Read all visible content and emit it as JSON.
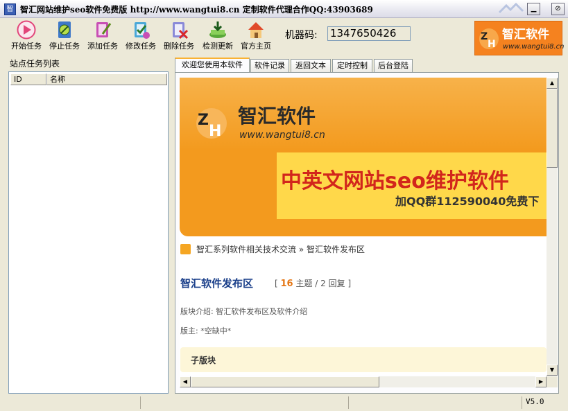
{
  "window": {
    "title": "智汇网站维护seo软件免费版  http://www.wangtui8.cn  定制软件代理合作QQ:43903689",
    "app_icon": "app-icon",
    "minimize_symbol": "▁",
    "close_symbol": "⊘"
  },
  "toolbar": {
    "items": [
      {
        "label": "开始任务",
        "icon": "play-icon"
      },
      {
        "label": "停止任务",
        "icon": "stop-icon"
      },
      {
        "label": "添加任务",
        "icon": "add-task-icon"
      },
      {
        "label": "修改任务",
        "icon": "edit-task-icon"
      },
      {
        "label": "删除任务",
        "icon": "delete-task-icon"
      },
      {
        "label": "检测更新",
        "icon": "update-icon"
      },
      {
        "label": "官方主页",
        "icon": "home-page-icon"
      }
    ],
    "machine_code_label": "机器码:",
    "machine_code_value": "1347650426"
  },
  "logo": {
    "text": "智汇软件",
    "url": "www.wangtui8.cn",
    "mark": "ZH"
  },
  "left_panel": {
    "title": "站点任务列表",
    "columns": [
      "ID",
      "名称"
    ]
  },
  "tabs": [
    {
      "label": "欢迎您使用本软件",
      "active": true
    },
    {
      "label": "软件记录",
      "active": false
    },
    {
      "label": "返回文本",
      "active": false
    },
    {
      "label": "定时控制",
      "active": false
    },
    {
      "label": "后台登陆",
      "active": false
    }
  ],
  "web": {
    "banner_name": "智汇软件",
    "banner_url": "www.wangtui8.cn",
    "banner_mark": "ZH",
    "banner_slogan": "中英文网站seo维护软件",
    "banner_qq": "加QQ群112590040免费下",
    "breadcrumb_1": "智汇系列软件相关技术交流",
    "breadcrumb_sep": "»",
    "breadcrumb_2": "智汇软件发布区",
    "forum_title": "智汇软件发布区",
    "stats_open": "[",
    "stats_topics": "16",
    "stats_topics_label": "主题",
    "stats_sep": "/",
    "stats_replies": "2",
    "stats_replies_label": "回复",
    "stats_close": "]",
    "intro": "版块介绍: 智汇软件发布区及软件介绍",
    "moderator": "版主: *空缺中*",
    "sub_forum": "子版块"
  },
  "status": {
    "version": "V5.0"
  },
  "colors": {
    "accent": "#f5821f",
    "tab_active": "#f9b233",
    "title_blue": "#1a3f8a",
    "slogan_red": "#d2261c"
  }
}
